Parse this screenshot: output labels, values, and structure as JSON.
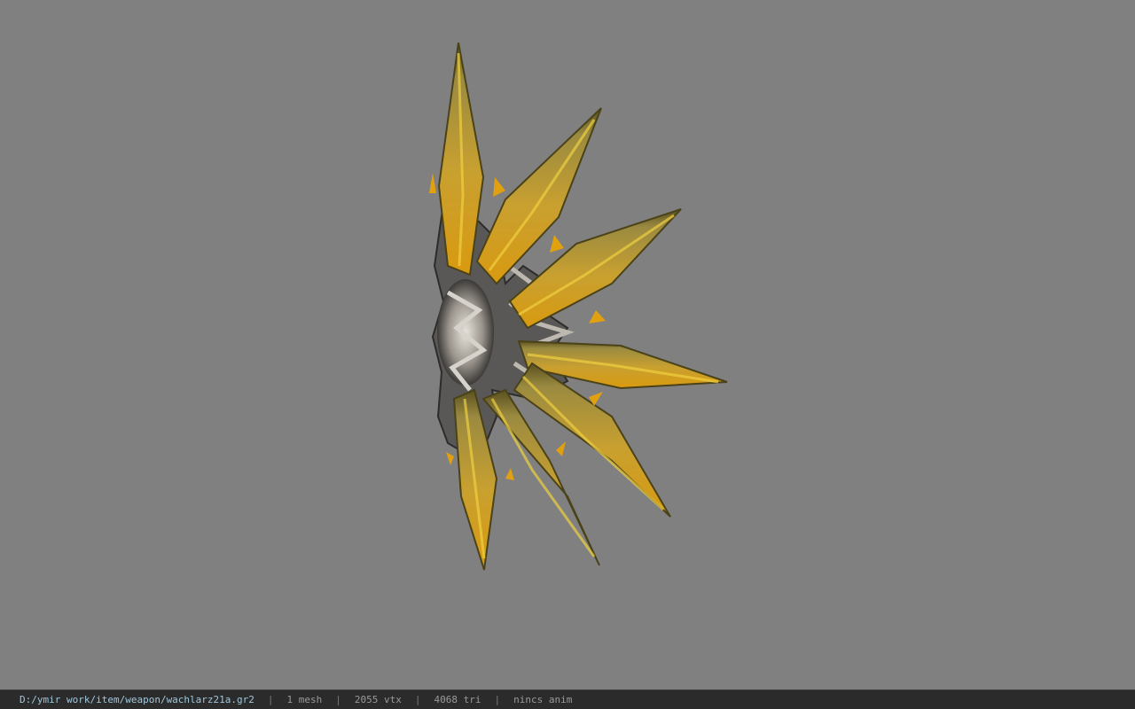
{
  "viewer": {
    "background_color": "#808080",
    "model_icon": "fan-blade-weapon-model"
  },
  "status": {
    "file_path": "D:/ymir work/item/weapon/wachlarz21a.gr2",
    "separator": "|",
    "mesh_count": "1 mesh",
    "vertex_count": "2055 vtx",
    "triangle_count": "4068 tri",
    "animation": "nincs anim"
  }
}
